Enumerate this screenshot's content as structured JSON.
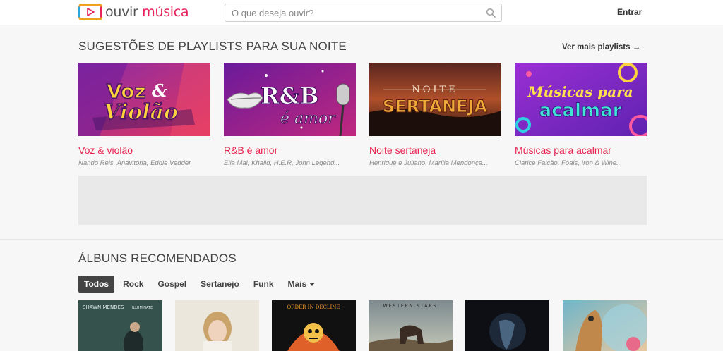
{
  "header": {
    "logo": {
      "part1": "ouvir ",
      "part2": "música"
    },
    "search": {
      "placeholder": "O que deseja ouvir?"
    },
    "login_label": "Entrar"
  },
  "playlists": {
    "title": "SUGESTÕES DE PLAYLISTS PARA SUA NOITE",
    "see_more": "Ver mais playlists →",
    "items": [
      {
        "title": "Voz & violão",
        "artists": "Nando Reis, Anavitória, Eddie Vedder",
        "art": "Voz & Violão"
      },
      {
        "title": "R&B é amor",
        "artists": "Ella Mai, Khalid, H.E.R, John Legend...",
        "art": "R&B é amor"
      },
      {
        "title": "Noite sertaneja",
        "artists": "Henrique e Juliano, Marília Mendonça...",
        "art": "NOITE SERTANEJA"
      },
      {
        "title": "Músicas para acalmar",
        "artists": "Clarice Falcão, Foals, Iron & Wine...",
        "art": "Músicas para acalmar"
      }
    ]
  },
  "albums": {
    "title": "ÁLBUNS RECOMENDADOS",
    "filters": [
      "Todos",
      "Rock",
      "Gospel",
      "Sertanejo",
      "Funk",
      "Mais"
    ],
    "active_filter": "Todos",
    "covers": [
      "SHAWN MENDES",
      "ILLUMINATE",
      "ORDER IN DECLINE",
      "WESTERN STARS"
    ]
  },
  "colors": {
    "accent": "#e8224f",
    "active_filter_bg": "#444444"
  },
  "icons": {
    "search": "search-icon",
    "logo": "play-icon",
    "dropdown": "caret-down-icon"
  }
}
